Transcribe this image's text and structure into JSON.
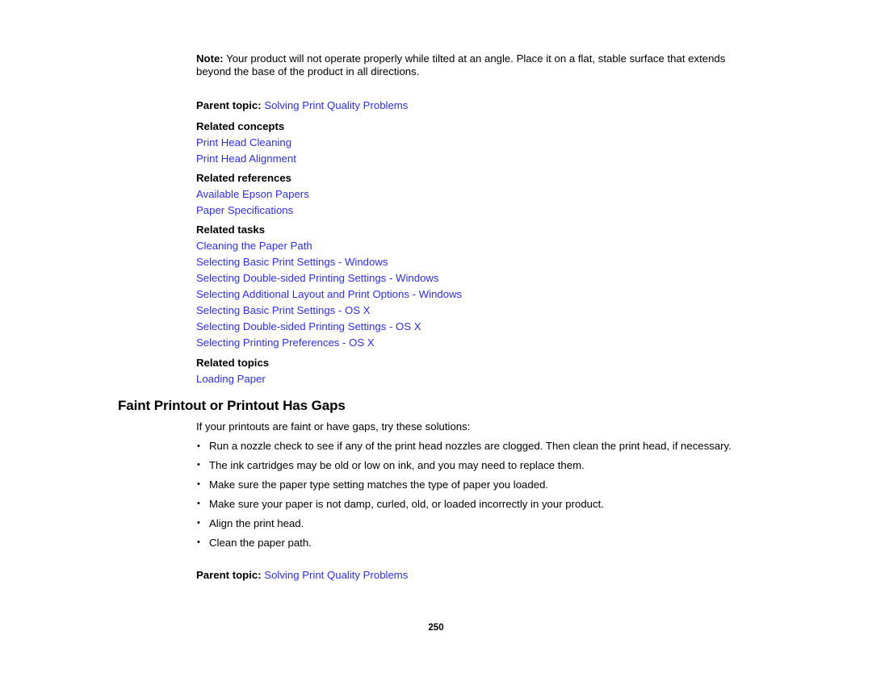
{
  "document": {
    "note": {
      "label": "Note:",
      "text": " Your product will not operate properly while tilted at an angle. Place it on a flat, stable surface that extends beyond the base of the product in all directions."
    },
    "parent_topic_top": {
      "label": "Parent topic:",
      "link": "Solving Print Quality Problems"
    },
    "related_groups": [
      {
        "heading": "Related concepts",
        "links": [
          "Print Head Cleaning",
          "Print Head Alignment"
        ]
      },
      {
        "heading": "Related references",
        "links": [
          "Available Epson Papers",
          "Paper Specifications"
        ]
      },
      {
        "heading": "Related tasks",
        "links": [
          "Cleaning the Paper Path",
          "Selecting Basic Print Settings - Windows",
          "Selecting Double-sided Printing Settings - Windows",
          "Selecting Additional Layout and Print Options - Windows",
          "Selecting Basic Print Settings - OS X",
          "Selecting Double-sided Printing Settings - OS X",
          "Selecting Printing Preferences - OS X"
        ]
      },
      {
        "heading": "Related topics",
        "links": [
          "Loading Paper"
        ]
      }
    ],
    "section": {
      "title": "Faint Printout or Printout Has Gaps",
      "intro": "If your printouts are faint or have gaps, try these solutions:",
      "bullets": [
        "Run a nozzle check to see if any of the print head nozzles are clogged. Then clean the print head, if necessary.",
        "The ink cartridges may be old or low on ink, and you may need to replace them.",
        "Make sure the paper type setting matches the type of paper you loaded.",
        "Make sure your paper is not damp, curled, old, or loaded incorrectly in your product.",
        "Align the print head.",
        "Clean the paper path."
      ]
    },
    "parent_topic_bottom": {
      "label": "Parent topic:",
      "link": "Solving Print Quality Problems"
    },
    "page_number": "250",
    "colors": {
      "link": "#2f2fdd",
      "text": "#000000",
      "background": "#ffffff"
    }
  }
}
